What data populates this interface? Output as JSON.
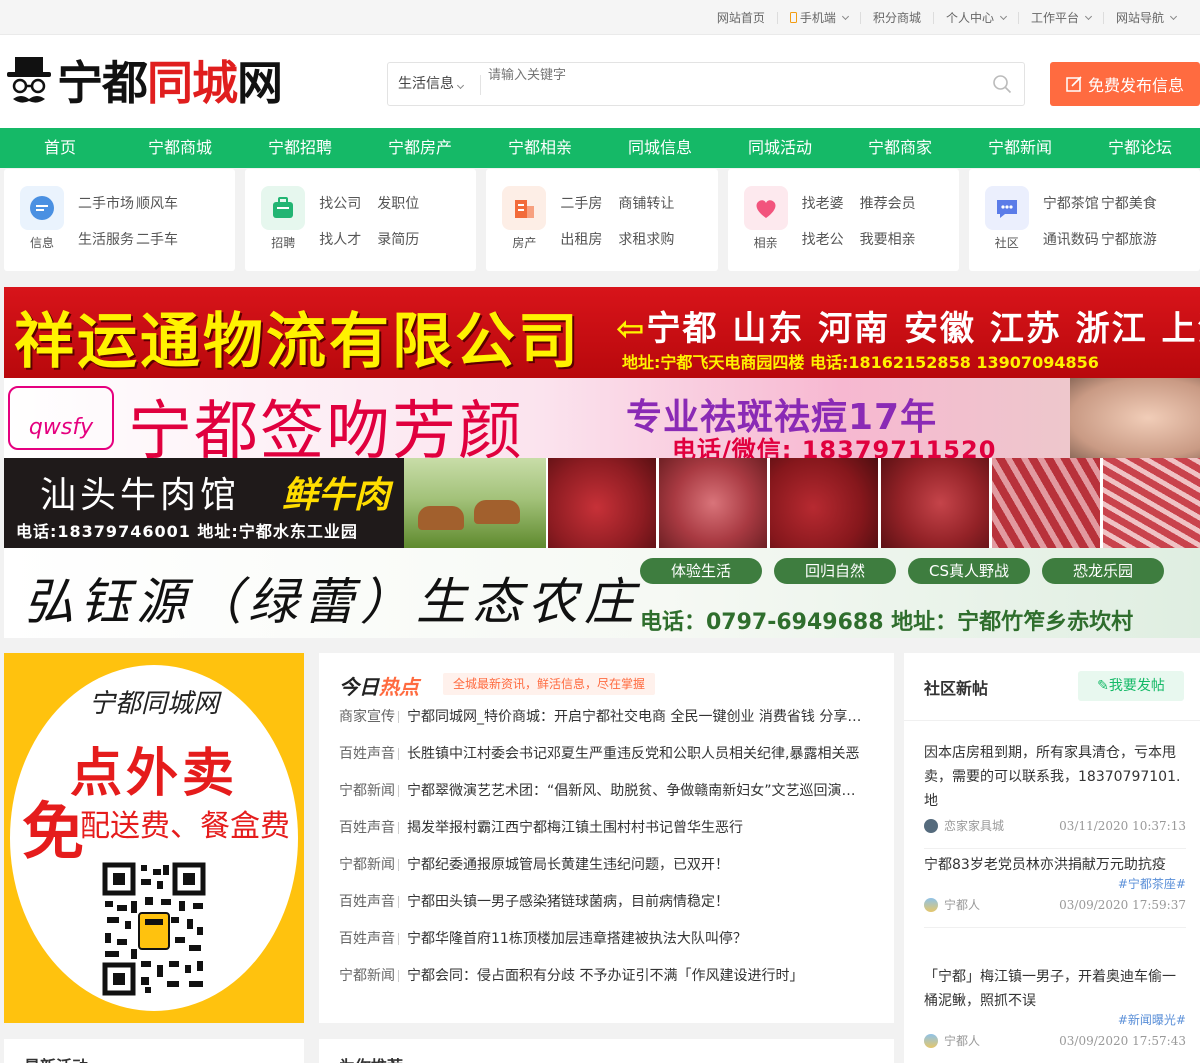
{
  "topbar": {
    "items": [
      "网站首页",
      "手机端",
      "积分商城",
      "个人中心",
      "工作平台",
      "网站导航"
    ]
  },
  "logo": {
    "part1": "宁都",
    "part2": "同城",
    "part3": "网"
  },
  "search": {
    "category": "生活信息",
    "placeholder": "请输入关键字"
  },
  "publish_label": "免费发布信息",
  "nav": [
    "首页",
    "宁都商城",
    "宁都招聘",
    "宁都房产",
    "宁都相亲",
    "同城信息",
    "同城活动",
    "宁都商家",
    "宁都新闻",
    "宁都论坛"
  ],
  "categories": [
    {
      "label": "信息",
      "icon": "chat-bubble-icon",
      "color": "#4a90e2",
      "links": [
        "二手市场",
        "顺风车",
        "生活服务",
        "二手车"
      ]
    },
    {
      "label": "招聘",
      "icon": "briefcase-icon",
      "color": "#22b573",
      "links": [
        "找公司",
        "发职位",
        "找人才",
        "录简历"
      ]
    },
    {
      "label": "房产",
      "icon": "building-icon",
      "color": "#f26b3a",
      "links": [
        "二手房",
        "商铺转让",
        "出租房",
        "求租求购"
      ]
    },
    {
      "label": "相亲",
      "icon": "heart-icon",
      "color": "#f2547d",
      "links": [
        "找老婆",
        "推荐会员",
        "找老公",
        "我要相亲"
      ]
    },
    {
      "label": "社区",
      "icon": "message-icon",
      "color": "#5b7ce8",
      "links": [
        "宁都茶馆",
        "宁都美食",
        "通讯数码",
        "宁都旅游"
      ]
    }
  ],
  "ads": {
    "ad1": {
      "name": "祥运通物流有限公司",
      "routes": "宁都 山东 河南 安徽 江苏 浙江 上海",
      "address": "地址:宁都飞天电商园四楼  电话:18162152858 13907094856"
    },
    "ad2": {
      "logo": "qwsfy",
      "name": "宁都签吻芳颜",
      "slogan": "专业祛斑祛痘17年",
      "tel": "电话/微信: 18379711520"
    },
    "ad3": {
      "name": "汕头牛肉馆",
      "badge": "鲜牛肉",
      "info": "电话:18379746001  地址:宁都水东工业园"
    },
    "ad4": {
      "name": "弘钰源（绿蕾）生态农庄",
      "pills": [
        "体验生活",
        "回归自然",
        "CS真人野战",
        "恐龙乐园"
      ],
      "tel": "电话：0797-6949688  地址：宁都竹笮乡赤坎村"
    }
  },
  "promo": {
    "brand": "宁都同城网",
    "big": "点外卖",
    "mian": "免",
    "free": "配送费、餐盒费"
  },
  "hot": {
    "title_a": "今日",
    "title_b": "热点",
    "subtitle": "全城最新资讯，鲜活信息，尽在掌握",
    "items": [
      {
        "tag": "商家宣传",
        "text": "宁都同城网_特价商城：开启宁都社交电商 全民一键创业 消费省钱 分享…"
      },
      {
        "tag": "百姓声音",
        "text": "长胜镇中江村委会书记邓夏生严重违反党和公职人员相关纪律,暴露相关恶"
      },
      {
        "tag": "宁都新闻",
        "text": "宁都翠微演艺艺术团：“倡新风、助脱贫、争做赣南新妇女”文艺巡回演…"
      },
      {
        "tag": "百姓声音",
        "text": "揭发举报村霸江西宁都梅江镇土围村村书记曾华生恶行"
      },
      {
        "tag": "宁都新闻",
        "text": "宁都纪委通报原城管局长黄建生违纪问题，已双开！"
      },
      {
        "tag": "百姓声音",
        "text": "宁都田头镇一男子感染猪链球菌病，目前病情稳定！"
      },
      {
        "tag": "百姓声音",
        "text": "宁都华隆首府11栋顶楼加层违章搭建被执法大队叫停？"
      },
      {
        "tag": "宁都新闻",
        "text": "宁都会同：侵占面积有分歧 不予办证引不满「作风建设进行时」"
      }
    ]
  },
  "community": {
    "title": "社区新帖",
    "button": "我要发帖",
    "posts": [
      {
        "title": "因本店房租到期，所有家具清仓，亏本甩卖，需要的可以联系我，18370797101. 地",
        "topic": "",
        "author": "恋家家具城",
        "time": "03/11/2020 10:37:13"
      },
      {
        "title": "宁都83岁老党员林亦洪捐献万元助抗疫",
        "topic": "#宁都茶座#",
        "author": "宁都人",
        "time": "03/09/2020 17:59:37"
      },
      {
        "title": "「宁都」梅江镇一男子，开着奥迪车偷一桶泥鳅，照抓不误",
        "topic": "#新闻曝光#",
        "author": "宁都人",
        "time": "03/09/2020 17:57:43"
      }
    ]
  },
  "lower": {
    "left_title": "最新活动",
    "mid_title": "为你推荐"
  }
}
